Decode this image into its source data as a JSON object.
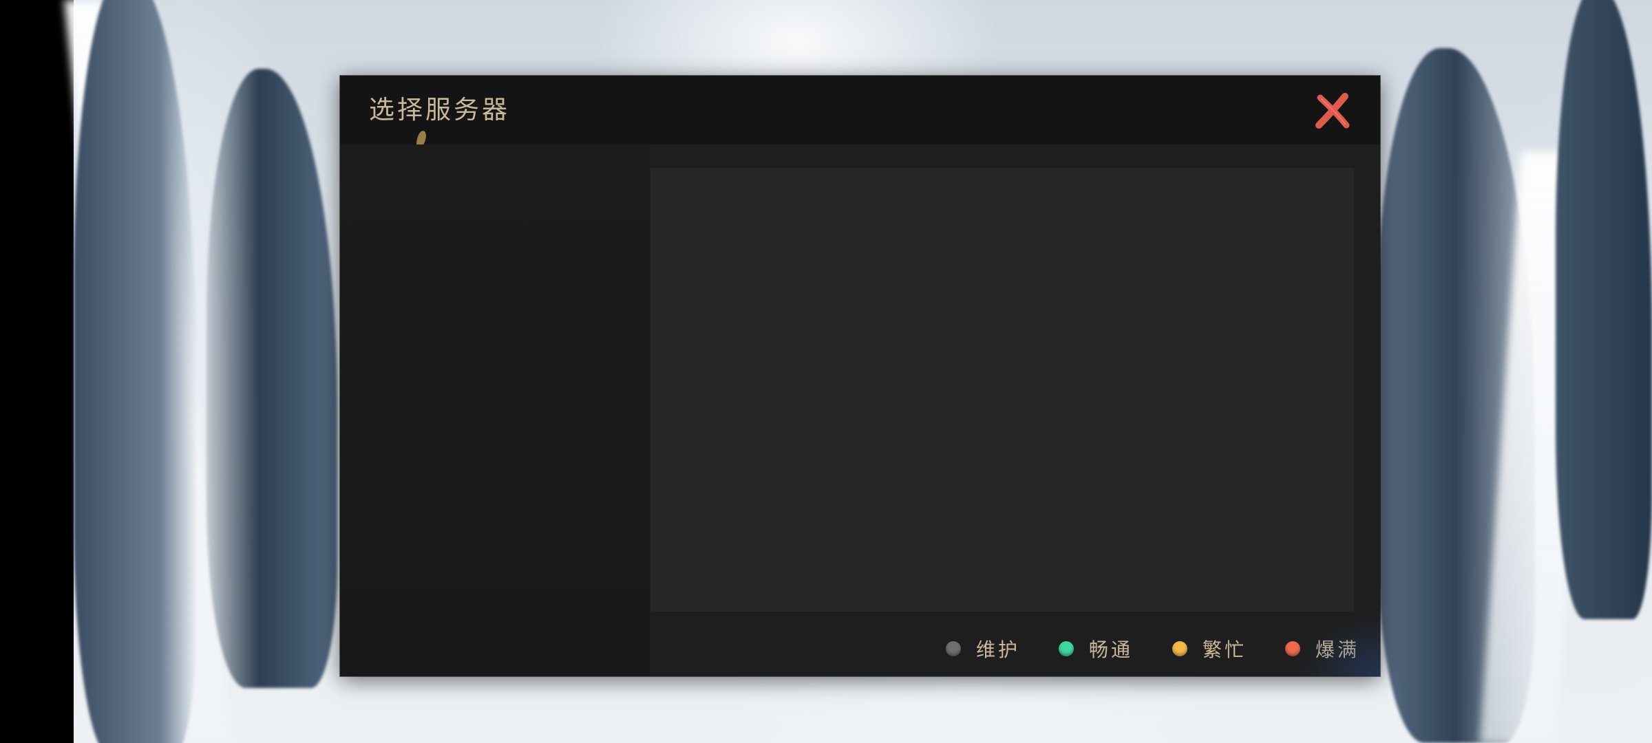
{
  "dialog": {
    "title": "选择服务器",
    "close_icon": "close-x-icon",
    "colors": {
      "title": "#c9b89a",
      "close": "#e05a4e",
      "panel": "#262626",
      "header": "#141414"
    }
  },
  "legend": {
    "items": [
      {
        "label": "维护",
        "color": "#6f6f6f"
      },
      {
        "label": "畅通",
        "color": "#3fd8a0"
      },
      {
        "label": "繁忙",
        "color": "#f2b84a"
      },
      {
        "label": "爆满",
        "color": "#ef6a4f"
      }
    ]
  },
  "servers": []
}
